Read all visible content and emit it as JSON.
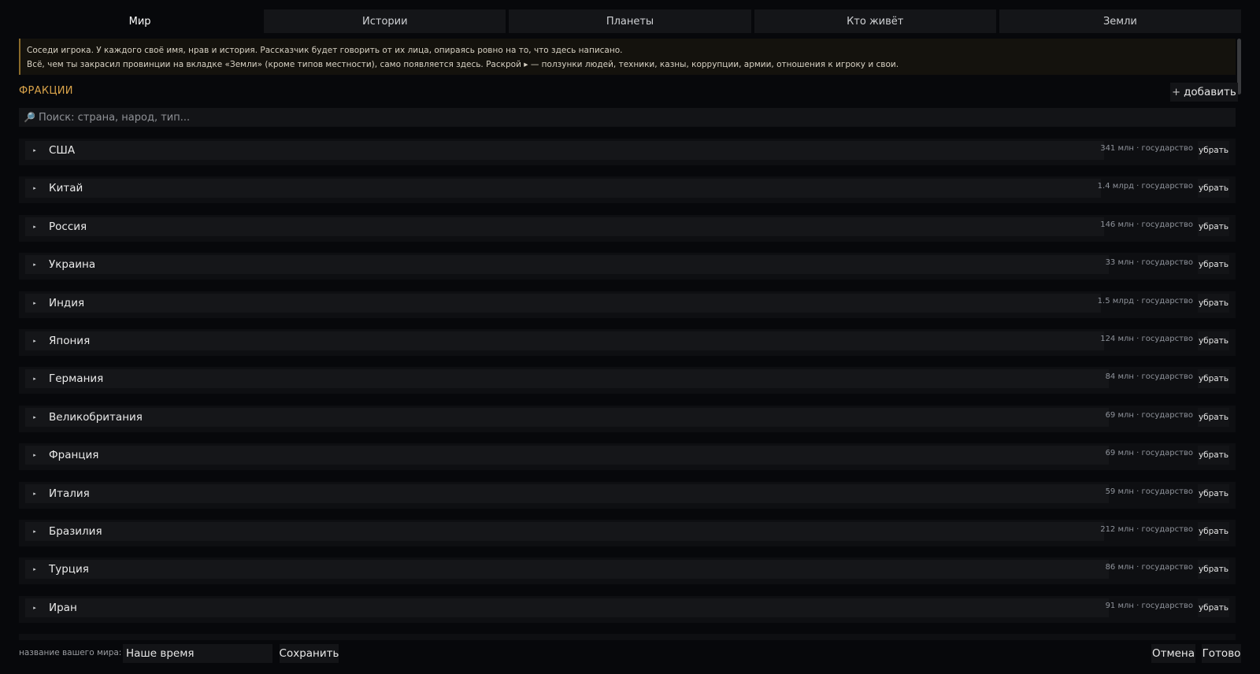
{
  "tabs": [
    {
      "label": "Мир",
      "active": true
    },
    {
      "label": "Истории"
    },
    {
      "label": "Планеты"
    },
    {
      "label": "Кто живёт"
    },
    {
      "label": "Земли"
    }
  ],
  "info": {
    "line1": "Соседи игрока. У каждого своё имя, нрав и история. Рассказчик будет говорить от их лица, опираясь ровно на то, что здесь написано.",
    "line2": "Всё, чем ты закрасил провинции на вкладке «Земли» (кроме типов местности), само появляется здесь. Раскрой ▸ — ползунки людей, техники, казны, коррупции, армии, отношения к игроку и свои."
  },
  "section": {
    "title": "ФРАКЦИИ",
    "add_label": "добавить",
    "add_icon": "plus-icon"
  },
  "search": {
    "placeholder": "Поиск: страна, народ, тип...",
    "icon": "magnifier-icon"
  },
  "remove_label": "убрать",
  "factions": [
    {
      "name": "США",
      "meta": "341 млн · государство"
    },
    {
      "name": "Китай",
      "meta": "1.4 млрд · государство"
    },
    {
      "name": "Россия",
      "meta": "146 млн · государство"
    },
    {
      "name": "Украина",
      "meta": "33 млн · государство"
    },
    {
      "name": "Индия",
      "meta": "1.5 млрд · государство"
    },
    {
      "name": "Япония",
      "meta": "124 млн · государство"
    },
    {
      "name": "Германия",
      "meta": "84 млн · государство"
    },
    {
      "name": "Великобритания",
      "meta": "69 млн · государство"
    },
    {
      "name": "Франция",
      "meta": "69 млн · государство"
    },
    {
      "name": "Италия",
      "meta": "59 млн · государство"
    },
    {
      "name": "Бразилия",
      "meta": "212 млн · государство"
    },
    {
      "name": "Турция",
      "meta": "86 млн · государство"
    },
    {
      "name": "Иран",
      "meta": "91 млн · государство"
    }
  ],
  "footer": {
    "world_name_label": "название вашего мира:",
    "world_name_value": "Наше время",
    "save_label": "Сохранить",
    "cancel_label": "Отмена",
    "done_label": "Готово"
  },
  "colors": {
    "accent": "#d9a34a",
    "background": "#07080b",
    "info_border": "#8a6a2a"
  }
}
